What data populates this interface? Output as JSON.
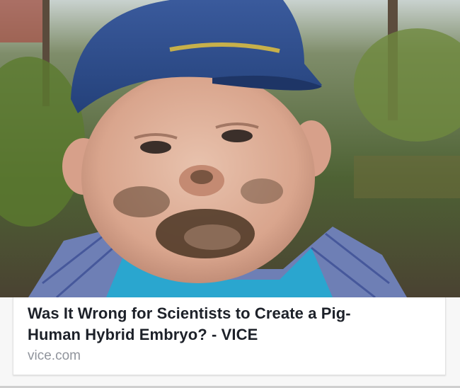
{
  "link_preview": {
    "headline": "Was It Wrong for Scientists to Create a Pig-Human Hybrid Embryo? - VICE",
    "headline_line1": "Was It Wrong for Scientists to Create a Pig-",
    "headline_line2": "Human Hybrid Embryo? - VICE",
    "domain": "vice.com"
  },
  "photo": {
    "subject": "toddler-with-muddy-face",
    "cap_color": "#2f4f8f",
    "shirt_color": "#2aa6cf"
  }
}
